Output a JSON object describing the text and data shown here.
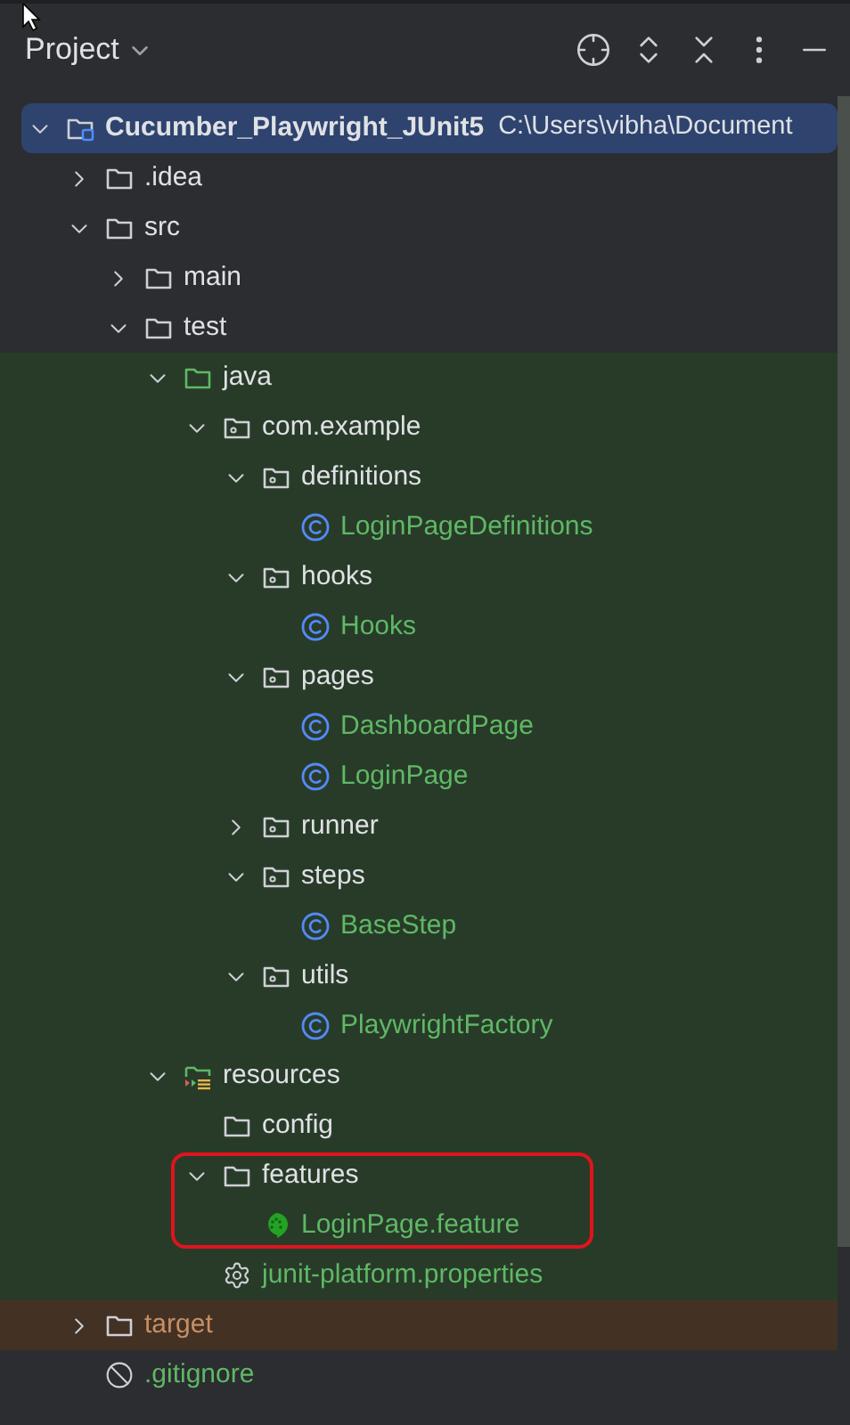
{
  "panel": {
    "title": "Project"
  },
  "tree": [
    {
      "name": "Cucumber_Playwright_JUnit5",
      "path": "C:\\Users\\vibha\\Document",
      "kind": "project",
      "color": "#dfe1e5",
      "test_scope": false,
      "excluded": false,
      "expanded": true,
      "selected": true,
      "children": [
        {
          "name": ".idea",
          "kind": "folder",
          "color": "#dfe1e5",
          "test_scope": false,
          "excluded": false,
          "expanded": false,
          "selected": false
        },
        {
          "name": "src",
          "kind": "folder",
          "color": "#dfe1e5",
          "test_scope": false,
          "excluded": false,
          "expanded": true,
          "selected": false,
          "children": [
            {
              "name": "main",
              "kind": "folder",
              "color": "#dfe1e5",
              "test_scope": false,
              "excluded": false,
              "expanded": false,
              "selected": false
            },
            {
              "name": "test",
              "kind": "folder",
              "color": "#dfe1e5",
              "test_scope": false,
              "excluded": false,
              "expanded": true,
              "selected": false,
              "children": [
                {
                  "name": "java",
                  "kind": "source-root",
                  "color": "#dfe1e5",
                  "test_scope": true,
                  "excluded": false,
                  "expanded": true,
                  "selected": false,
                  "children": [
                    {
                      "name": "com.example",
                      "kind": "package",
                      "color": "#dfe1e5",
                      "test_scope": true,
                      "excluded": false,
                      "expanded": true,
                      "selected": false,
                      "children": [
                        {
                          "name": "definitions",
                          "kind": "package",
                          "color": "#dfe1e5",
                          "test_scope": true,
                          "excluded": false,
                          "expanded": true,
                          "selected": false,
                          "children": [
                            {
                              "name": "LoginPageDefinitions",
                              "kind": "class",
                              "color": "#5fb865",
                              "test_scope": true,
                              "excluded": false,
                              "selected": false
                            }
                          ]
                        },
                        {
                          "name": "hooks",
                          "kind": "package",
                          "color": "#dfe1e5",
                          "test_scope": true,
                          "excluded": false,
                          "expanded": true,
                          "selected": false,
                          "children": [
                            {
                              "name": "Hooks",
                              "kind": "class",
                              "color": "#5fb865",
                              "test_scope": true,
                              "excluded": false,
                              "selected": false
                            }
                          ]
                        },
                        {
                          "name": "pages",
                          "kind": "package",
                          "color": "#dfe1e5",
                          "test_scope": true,
                          "excluded": false,
                          "expanded": true,
                          "selected": false,
                          "children": [
                            {
                              "name": "DashboardPage",
                              "kind": "class",
                              "color": "#5fb865",
                              "test_scope": true,
                              "excluded": false,
                              "selected": false
                            },
                            {
                              "name": "LoginPage",
                              "kind": "class",
                              "color": "#5fb865",
                              "test_scope": true,
                              "excluded": false,
                              "selected": false
                            }
                          ]
                        },
                        {
                          "name": "runner",
                          "kind": "package",
                          "color": "#dfe1e5",
                          "test_scope": true,
                          "excluded": false,
                          "expanded": false,
                          "selected": false
                        },
                        {
                          "name": "steps",
                          "kind": "package",
                          "color": "#dfe1e5",
                          "test_scope": true,
                          "excluded": false,
                          "expanded": true,
                          "selected": false,
                          "children": [
                            {
                              "name": "BaseStep",
                              "kind": "class",
                              "color": "#5fb865",
                              "test_scope": true,
                              "excluded": false,
                              "selected": false
                            }
                          ]
                        },
                        {
                          "name": "utils",
                          "kind": "package",
                          "color": "#dfe1e5",
                          "test_scope": true,
                          "excluded": false,
                          "expanded": true,
                          "selected": false,
                          "children": [
                            {
                              "name": "PlaywrightFactory",
                              "kind": "class",
                              "color": "#5fb865",
                              "test_scope": true,
                              "excluded": false,
                              "selected": false
                            }
                          ]
                        }
                      ]
                    }
                  ]
                },
                {
                  "name": "resources",
                  "kind": "resources-root",
                  "color": "#dfe1e5",
                  "test_scope": true,
                  "excluded": false,
                  "expanded": true,
                  "selected": false,
                  "children": [
                    {
                      "name": "config",
                      "kind": "folder",
                      "color": "#dfe1e5",
                      "test_scope": true,
                      "excluded": false,
                      "outlined": false,
                      "selected": false
                    },
                    {
                      "name": "features",
                      "kind": "folder",
                      "color": "#dfe1e5",
                      "test_scope": true,
                      "excluded": false,
                      "expanded": true,
                      "outlined": true,
                      "selected": false,
                      "children": [
                        {
                          "name": "LoginPage.feature",
                          "kind": "feature",
                          "color": "#5fb865",
                          "test_scope": true,
                          "excluded": false,
                          "selected": false
                        }
                      ]
                    },
                    {
                      "name": "junit-platform.properties",
                      "kind": "properties",
                      "color": "#5fb865",
                      "test_scope": true,
                      "excluded": false,
                      "outlined": false,
                      "selected": false
                    }
                  ]
                }
              ]
            }
          ]
        },
        {
          "name": "target",
          "kind": "folder",
          "color": "#c98e65",
          "test_scope": false,
          "excluded": true,
          "expanded": false,
          "selected": false
        },
        {
          "name": ".gitignore",
          "kind": "ignore",
          "color": "#5fb865",
          "test_scope": false,
          "excluded": false,
          "selected": false
        }
      ]
    }
  ]
}
